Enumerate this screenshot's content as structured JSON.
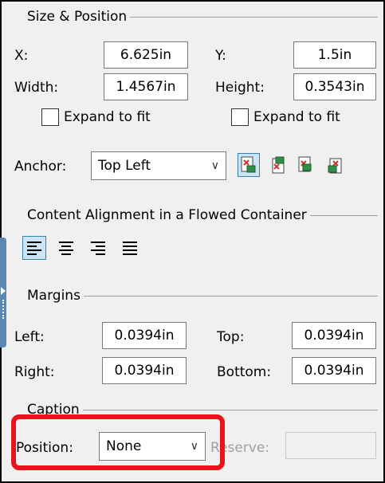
{
  "size_position": {
    "title": "Size & Position",
    "x_label": "X:",
    "x_value": "6.625in",
    "y_label": "Y:",
    "y_value": "1.5in",
    "width_label": "Width:",
    "width_value": "1.4567in",
    "height_label": "Height:",
    "height_value": "0.3543in",
    "expand_width_label": "Expand to fit",
    "expand_height_label": "Expand to fit",
    "anchor_label": "Anchor:",
    "anchor_value": "Top Left"
  },
  "content_alignment": {
    "title": "Content Alignment in a Flowed Container"
  },
  "margins": {
    "title": "Margins",
    "left_label": "Left:",
    "left_value": "0.0394in",
    "top_label": "Top:",
    "top_value": "0.0394in",
    "right_label": "Right:",
    "right_value": "0.0394in",
    "bottom_label": "Bottom:",
    "bottom_value": "0.0394in"
  },
  "caption": {
    "title": "Caption",
    "position_label": "Position:",
    "position_value": "None",
    "reserve_label": "Reserve:",
    "reserve_value": ""
  },
  "colors": {
    "highlight": "#e8141c",
    "selected_button_bg": "#cce4f7",
    "side_tab": "#5b87b5"
  }
}
